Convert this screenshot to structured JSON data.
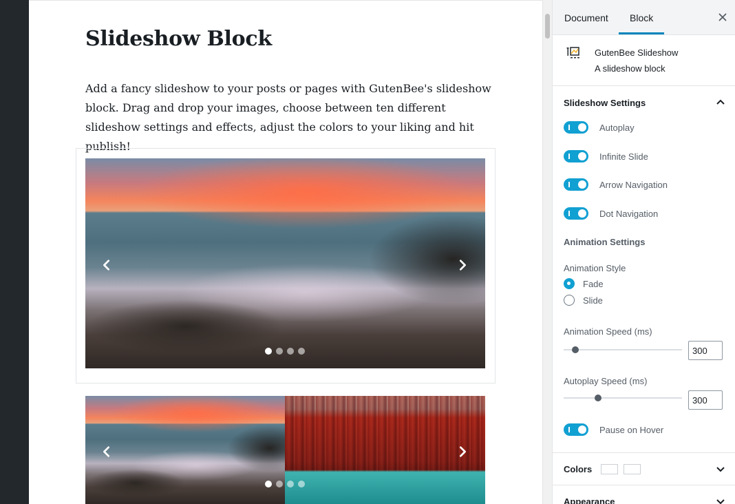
{
  "editor": {
    "title": "Slideshow Block",
    "paragraph": "Add a fancy slideshow to your posts or pages with GutenBee's slideshow block. Drag and drop your images, choose between ten different slideshow settings and effects, adjust the colors to your liking and hit publish!"
  },
  "slideshows": [
    {
      "active_dot": 1,
      "dot_count": 4,
      "prev_icon": "chevron-left-icon",
      "next_icon": "chevron-right-icon"
    },
    {
      "active_dot": 1,
      "dot_count": 4,
      "prev_icon": "chevron-left-icon",
      "next_icon": "chevron-right-icon"
    }
  ],
  "sidebar": {
    "tabs": [
      {
        "label": "Document",
        "active": false
      },
      {
        "label": "Block",
        "active": true
      }
    ],
    "block_card": {
      "name": "GutenBee Slideshow",
      "description": "A slideshow block"
    },
    "slideshow_settings": {
      "title": "Slideshow Settings",
      "toggles": [
        {
          "label": "Autoplay",
          "checked": true
        },
        {
          "label": "Infinite Slide",
          "checked": true
        },
        {
          "label": "Arrow Navigation",
          "checked": true
        },
        {
          "label": "Dot Navigation",
          "checked": true
        }
      ],
      "animation_heading": "Animation Settings",
      "animation_style_label": "Animation Style",
      "animation_styles": [
        {
          "label": "Fade",
          "checked": true
        },
        {
          "label": "Slide",
          "checked": false
        }
      ],
      "animation_speed": {
        "label": "Animation Speed (ms)",
        "value": "300"
      },
      "autoplay_speed": {
        "label": "Autoplay Speed (ms)",
        "value": "300"
      },
      "pause_on_hover": {
        "label": "Pause on Hover",
        "checked": true
      }
    },
    "colors": {
      "title": "Colors"
    },
    "appearance": {
      "title": "Appearance"
    }
  },
  "accent_color": "#11a0d2"
}
